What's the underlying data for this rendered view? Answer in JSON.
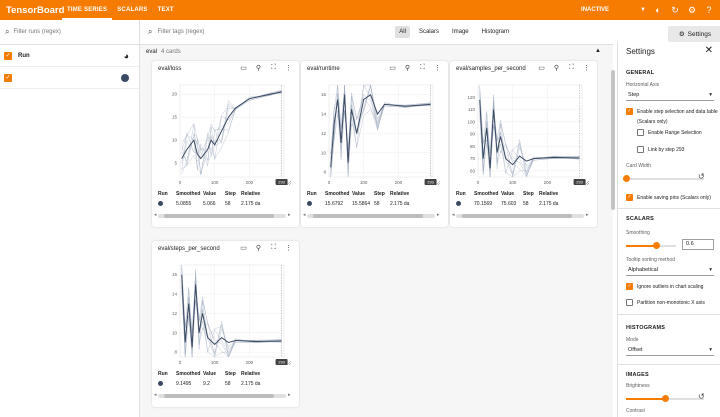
{
  "app": {
    "title": "TensorBoard",
    "tabs": [
      "TIME SERIES",
      "SCALARS",
      "TEXT"
    ],
    "status": "INACTIVE"
  },
  "left": {
    "filter_placeholder": "Filter runs (regex)",
    "header_label": "Run",
    "runs": [
      {
        "name": "",
        "color": "#3b4a63"
      }
    ]
  },
  "toolbar": {
    "filter_placeholder": "Filter tags (regex)",
    "views": [
      "All",
      "Scalars",
      "Image",
      "Histogram"
    ],
    "settings_label": "Settings"
  },
  "group": {
    "name": "eval",
    "count": "4 cards"
  },
  "table_headers": [
    "Run",
    "Smoothed",
    "Value",
    "Step",
    "Relative"
  ],
  "step_marker": "293",
  "cards": [
    {
      "title": "eval/loss",
      "smoothed": "5.0855",
      "value": "5.066",
      "step": "58",
      "relative": "2.175 da"
    },
    {
      "title": "eval/runtime",
      "smoothed": "15.6792",
      "value": "15.5864",
      "step": "58",
      "relative": "2.175 da"
    },
    {
      "title": "eval/samples_per_second",
      "smoothed": "70.1569",
      "value": "75.603",
      "step": "58",
      "relative": "2.175 da"
    },
    {
      "title": "eval/steps_per_second",
      "smoothed": "9.1495",
      "value": "9.2",
      "step": "58",
      "relative": "2.175 da"
    }
  ],
  "chart_data": [
    {
      "type": "line",
      "title": "eval/loss",
      "x_ticks": [
        0,
        100,
        200
      ],
      "y_ticks": [
        5,
        10,
        15,
        20
      ],
      "xlim": [
        0,
        300
      ],
      "ylim": [
        2,
        22
      ],
      "series": [
        {
          "values": [
            [
              5,
              6
            ],
            [
              20,
              8
            ],
            [
              40,
              10
            ],
            [
              50,
              7
            ],
            [
              60,
              6
            ],
            [
              80,
              8
            ],
            [
              90,
              10
            ],
            [
              100,
              9
            ],
            [
              120,
              12
            ],
            [
              140,
              15
            ],
            [
              160,
              17
            ],
            [
              200,
              19
            ],
            [
              260,
              20
            ],
            [
              293,
              20.5
            ]
          ]
        }
      ]
    },
    {
      "type": "line",
      "title": "eval/runtime",
      "x_ticks": [
        0,
        100,
        200
      ],
      "y_ticks": [
        8,
        10,
        12,
        14,
        16
      ],
      "xlim": [
        0,
        300
      ],
      "ylim": [
        7.5,
        17
      ],
      "series": [
        {
          "values": [
            [
              5,
              8.5
            ],
            [
              15,
              13
            ],
            [
              25,
              15.5
            ],
            [
              35,
              11
            ],
            [
              45,
              16
            ],
            [
              55,
              9
            ],
            [
              65,
              14.5
            ],
            [
              80,
              12
            ],
            [
              100,
              15.5
            ],
            [
              120,
              16
            ],
            [
              140,
              14
            ],
            [
              160,
              15
            ],
            [
              220,
              14.8
            ],
            [
              293,
              15
            ]
          ]
        }
      ]
    },
    {
      "type": "line",
      "title": "eval/samples_per_second",
      "x_ticks": [
        0,
        100,
        200
      ],
      "y_ticks": [
        60,
        70,
        80,
        90,
        100,
        110,
        120
      ],
      "xlim": [
        0,
        300
      ],
      "ylim": [
        55,
        130
      ],
      "series": [
        {
          "values": [
            [
              5,
              118
            ],
            [
              15,
              70
            ],
            [
              25,
              95
            ],
            [
              35,
              62
            ],
            [
              45,
              110
            ],
            [
              55,
              75
            ],
            [
              65,
              88
            ],
            [
              80,
              70
            ],
            [
              100,
              65
            ],
            [
              120,
              72
            ],
            [
              140,
              68
            ],
            [
              160,
              70
            ],
            [
              220,
              71
            ],
            [
              293,
              70.5
            ]
          ]
        }
      ]
    },
    {
      "type": "line",
      "title": "eval/steps_per_second",
      "x_ticks": [
        0,
        100,
        200
      ],
      "y_ticks": [
        8,
        10,
        12,
        14,
        16
      ],
      "xlim": [
        0,
        300
      ],
      "ylim": [
        7.5,
        17
      ],
      "series": [
        {
          "values": [
            [
              5,
              16
            ],
            [
              15,
              9
            ],
            [
              25,
              13
            ],
            [
              35,
              8.5
            ],
            [
              45,
              15
            ],
            [
              55,
              10
            ],
            [
              65,
              12
            ],
            [
              80,
              9.5
            ],
            [
              100,
              8.8
            ],
            [
              120,
              9.5
            ],
            [
              140,
              9
            ],
            [
              160,
              9.2
            ],
            [
              220,
              9.1
            ],
            [
              293,
              9.15
            ]
          ]
        }
      ]
    }
  ],
  "settings": {
    "title": "Settings",
    "general": "GENERAL",
    "horizontal_axis_label": "Horizontal Axis",
    "horizontal_axis_value": "Step",
    "enable_step_selection": "Enable step selection and data table",
    "scalars_only": "(Scalars only)",
    "enable_range_selection": "Enable Range Selection",
    "link_by_step": "Link by step 293",
    "card_width": "Card Width",
    "enable_saving_pins": "Enable saving pins (Scalars only)",
    "scalars": "SCALARS",
    "smoothing_label": "Smoothing",
    "smoothing_value": "0.6",
    "smoothing_fraction": 0.6,
    "tooltip_label": "Tooltip sorting method",
    "tooltip_value": "Alphabetical",
    "ignore_outliers": "Ignore outliers in chart scaling",
    "partition_label": "Partition non-monotonic X axis",
    "histograms": "HISTOGRAMS",
    "mode_label": "Mode",
    "mode_value": "Offset",
    "images": "IMAGES",
    "brightness_label": "Brightness",
    "brightness_fraction": 0.5,
    "contrast_label": "Contrast"
  }
}
